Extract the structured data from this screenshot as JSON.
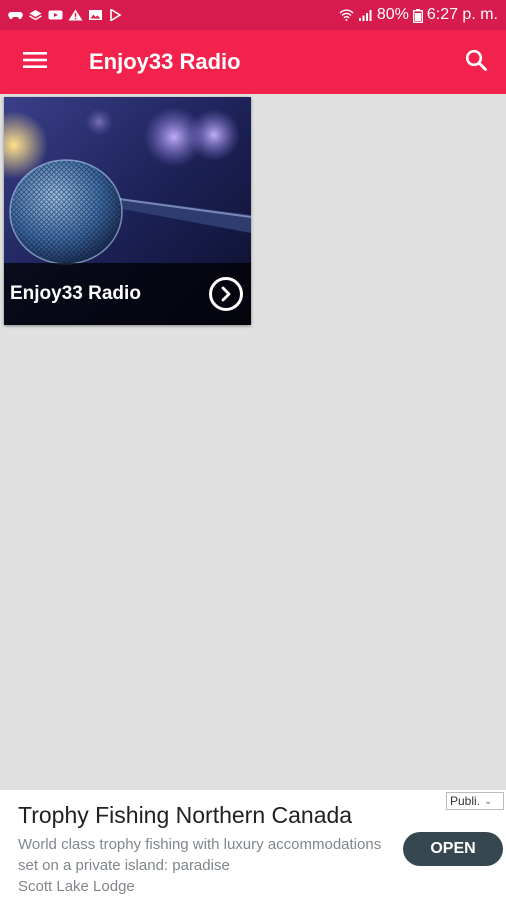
{
  "status_bar": {
    "battery": "80%",
    "time": "6:27 p. m.",
    "left_icons": [
      "gamepad-icon",
      "layers-icon",
      "youtube-icon",
      "warning-icon",
      "image-icon",
      "play-store-icon"
    ],
    "right_icons": [
      "wifi-icon",
      "signal-icon",
      "battery-icon"
    ]
  },
  "app_bar": {
    "title": "Enjoy33 Radio",
    "menu_icon": "hamburger-menu-icon",
    "search_icon": "search-icon"
  },
  "cards": [
    {
      "title": "Enjoy33 Radio",
      "image": "microphone-image",
      "action_icon": "chevron-right-circle-icon"
    }
  ],
  "ad": {
    "badge": "Publi.",
    "title": "Trophy Fishing Northern Canada",
    "body": "World class trophy fishing with luxury accommodations set on a private island: paradise",
    "advertiser": "Scott Lake Lodge",
    "button": "OPEN"
  },
  "colors": {
    "status_bar": "#d81b4f",
    "app_bar": "#f2224c",
    "background": "#e0e0e0",
    "ad_button": "#37474f"
  }
}
